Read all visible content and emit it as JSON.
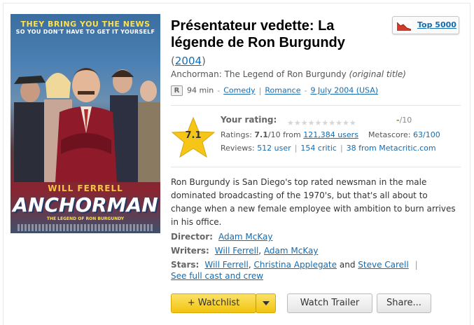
{
  "poster": {
    "tagline_1": "THEY BRING YOU THE NEWS",
    "tagline_2": "SO YOU DON'T HAVE TO GET IT YOURSELF",
    "actor": "WILL FERRELL",
    "movie_title": "ANCHORMAN",
    "subtitle": "THE LEGEND OF RON BURGUNDY"
  },
  "title": "Présentateur vedette: La légende de Ron Burgundy",
  "year": "2004",
  "original_title": "Anchorman: The Legend of Ron Burgundy",
  "original_title_note": "(original title)",
  "meta": {
    "certificate": "R",
    "runtime": "94 min",
    "genres": [
      "Comedy",
      "Romance"
    ],
    "release_date": "9 July 2004 (USA)"
  },
  "badge": {
    "label": "Top 5000",
    "icon": "chart-down-icon"
  },
  "rating": {
    "value": "7.1",
    "your_rating_label": "Your rating:",
    "your_rating_value": "-",
    "your_rating_max": "/10",
    "stars_count": 10,
    "ratings_label": "Ratings:",
    "ratings_value": "7.1",
    "ratings_max": "/10 from",
    "ratings_users": "121,384 users",
    "metascore_label": "Metascore:",
    "metascore": "63/100",
    "reviews_label": "Reviews:",
    "reviews_user": "512 user",
    "reviews_critic": "154 critic",
    "reviews_meta": "38 from Metacritic.com"
  },
  "description": "Ron Burgundy is San Diego's top rated newsman in the male dominated broadcasting of the 1970's, but that's all about to change when a new female employee with ambition to burn arrives in his office.",
  "credits": {
    "director_label": "Director:",
    "director": "Adam McKay",
    "writers_label": "Writers:",
    "writers": [
      "Will Ferrell",
      "Adam McKay"
    ],
    "stars_label": "Stars:",
    "stars": [
      "Will Ferrell",
      "Christina Applegate",
      "Steve Carell"
    ],
    "and": "and",
    "full_cast": "See full cast and crew"
  },
  "buttons": {
    "watchlist": "+ Watchlist",
    "trailer": "Watch Trailer",
    "share": "Share..."
  },
  "colors": {
    "link": "#136cb2",
    "watchlist": "#f2c30f",
    "star": "#f5c518"
  }
}
